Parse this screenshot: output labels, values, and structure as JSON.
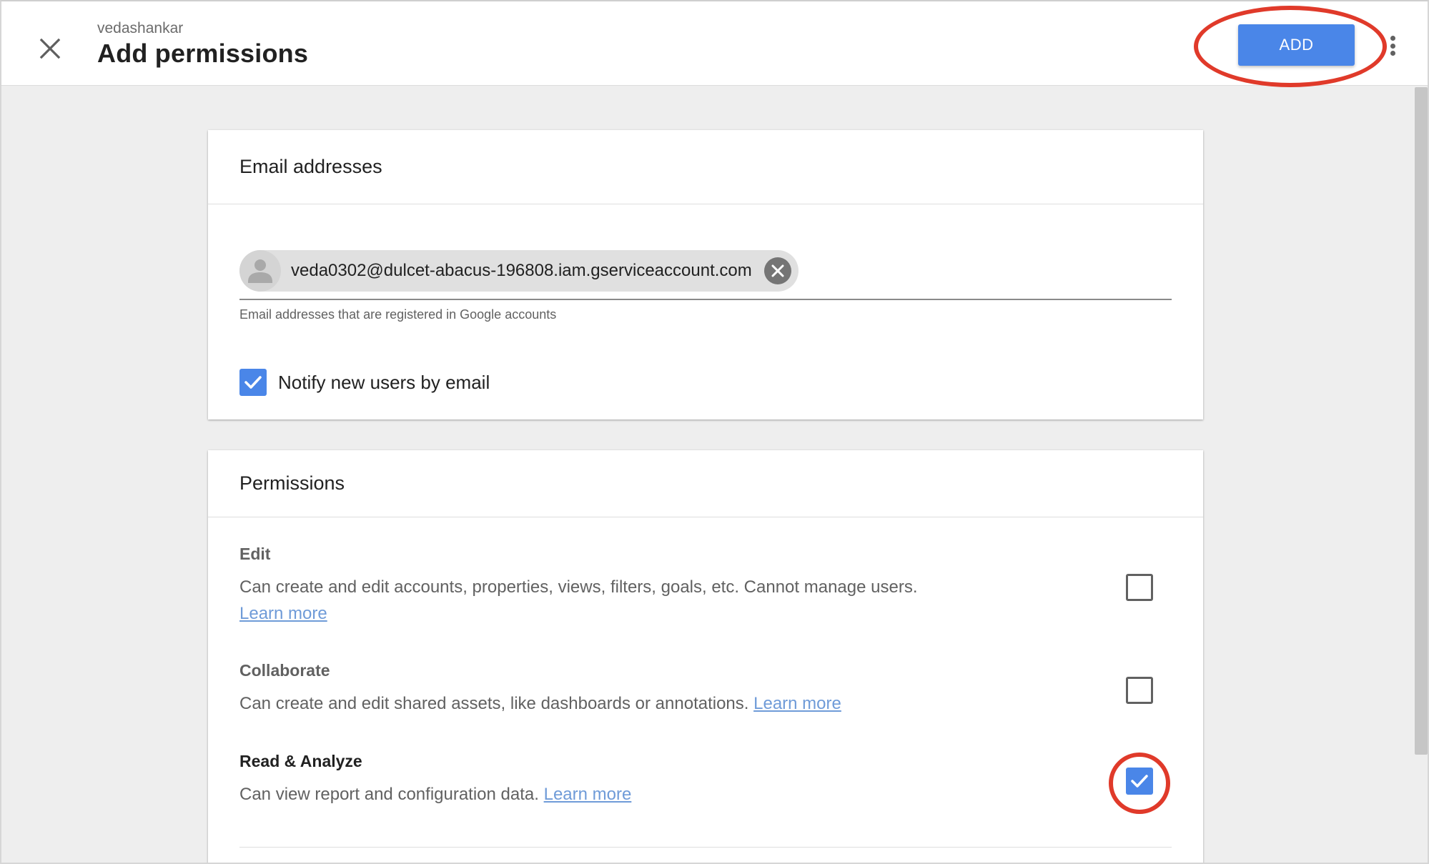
{
  "header": {
    "account": "vedashankar",
    "title": "Add permissions",
    "add_label": "ADD"
  },
  "email_card": {
    "title": "Email addresses",
    "chip_email": "veda0302@dulcet-abacus-196808.iam.gserviceaccount.com",
    "helper": "Email addresses that are registered in Google accounts",
    "notify_label": "Notify new users by email",
    "notify_checked": true
  },
  "permissions_card": {
    "title": "Permissions",
    "items": [
      {
        "title": "Edit",
        "desc": "Can create and edit accounts, properties, views, filters, goals, etc. Cannot manage users.",
        "link": "Learn more",
        "checked": false
      },
      {
        "title": "Collaborate",
        "desc": "Can create and edit shared assets, like dashboards or annotations.",
        "link": "Learn more",
        "checked": false
      },
      {
        "title": "Read & Analyze",
        "desc": "Can view report and configuration data.",
        "link": "Learn more",
        "checked": true
      }
    ]
  },
  "colors": {
    "accent": "#4a86e8",
    "highlight": "#e03a2a",
    "link": "#6f9bd8"
  },
  "icons": {
    "close": "close-icon",
    "more": "more-vert-icon",
    "avatar": "person-icon",
    "chip_remove": "remove-circle-icon",
    "check": "checkmark-icon"
  }
}
